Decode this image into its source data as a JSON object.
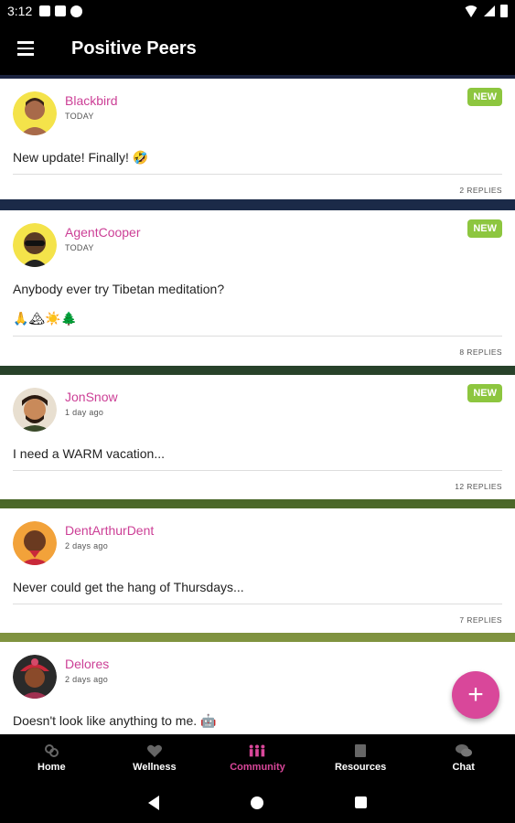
{
  "status_bar": {
    "time": "3:12"
  },
  "app_bar": {
    "title": "Positive Peers"
  },
  "posts": [
    {
      "author": "Blackbird",
      "when": "TODAY",
      "badge": "NEW",
      "text": "New update! Finally! 🤣",
      "emoji_line": "",
      "replies": "2 REPLIES"
    },
    {
      "author": "AgentCooper",
      "when": "TODAY",
      "badge": "NEW",
      "text": "Anybody ever try Tibetan meditation?",
      "emoji_line": "🙏🏔☀️🌲",
      "replies": "8 REPLIES"
    },
    {
      "author": "JonSnow",
      "when": "1 day ago",
      "badge": "NEW",
      "text": "I need a WARM vacation...",
      "emoji_line": "",
      "replies": "12 REPLIES"
    },
    {
      "author": "DentArthurDent",
      "when": "2 days ago",
      "badge": "",
      "text": "Never could get the hang of Thursdays...",
      "emoji_line": "",
      "replies": "7 REPLIES"
    },
    {
      "author": "Delores",
      "when": "2 days ago",
      "badge": "",
      "text": "Doesn't look like anything to me. 🤖",
      "emoji_line": "",
      "replies": ""
    }
  ],
  "fab": {
    "label": "+"
  },
  "bottom_nav": {
    "items": [
      {
        "label": "Home",
        "icon": "home-icon",
        "active": false
      },
      {
        "label": "Wellness",
        "icon": "heart-icon",
        "active": false
      },
      {
        "label": "Community",
        "icon": "people-icon",
        "active": true
      },
      {
        "label": "Resources",
        "icon": "book-icon",
        "active": false
      },
      {
        "label": "Chat",
        "icon": "chat-bubbles-icon",
        "active": false
      }
    ]
  },
  "colors": {
    "accent": "#d9479a",
    "new_badge": "#8dc63f",
    "author": "#cc3f96"
  }
}
